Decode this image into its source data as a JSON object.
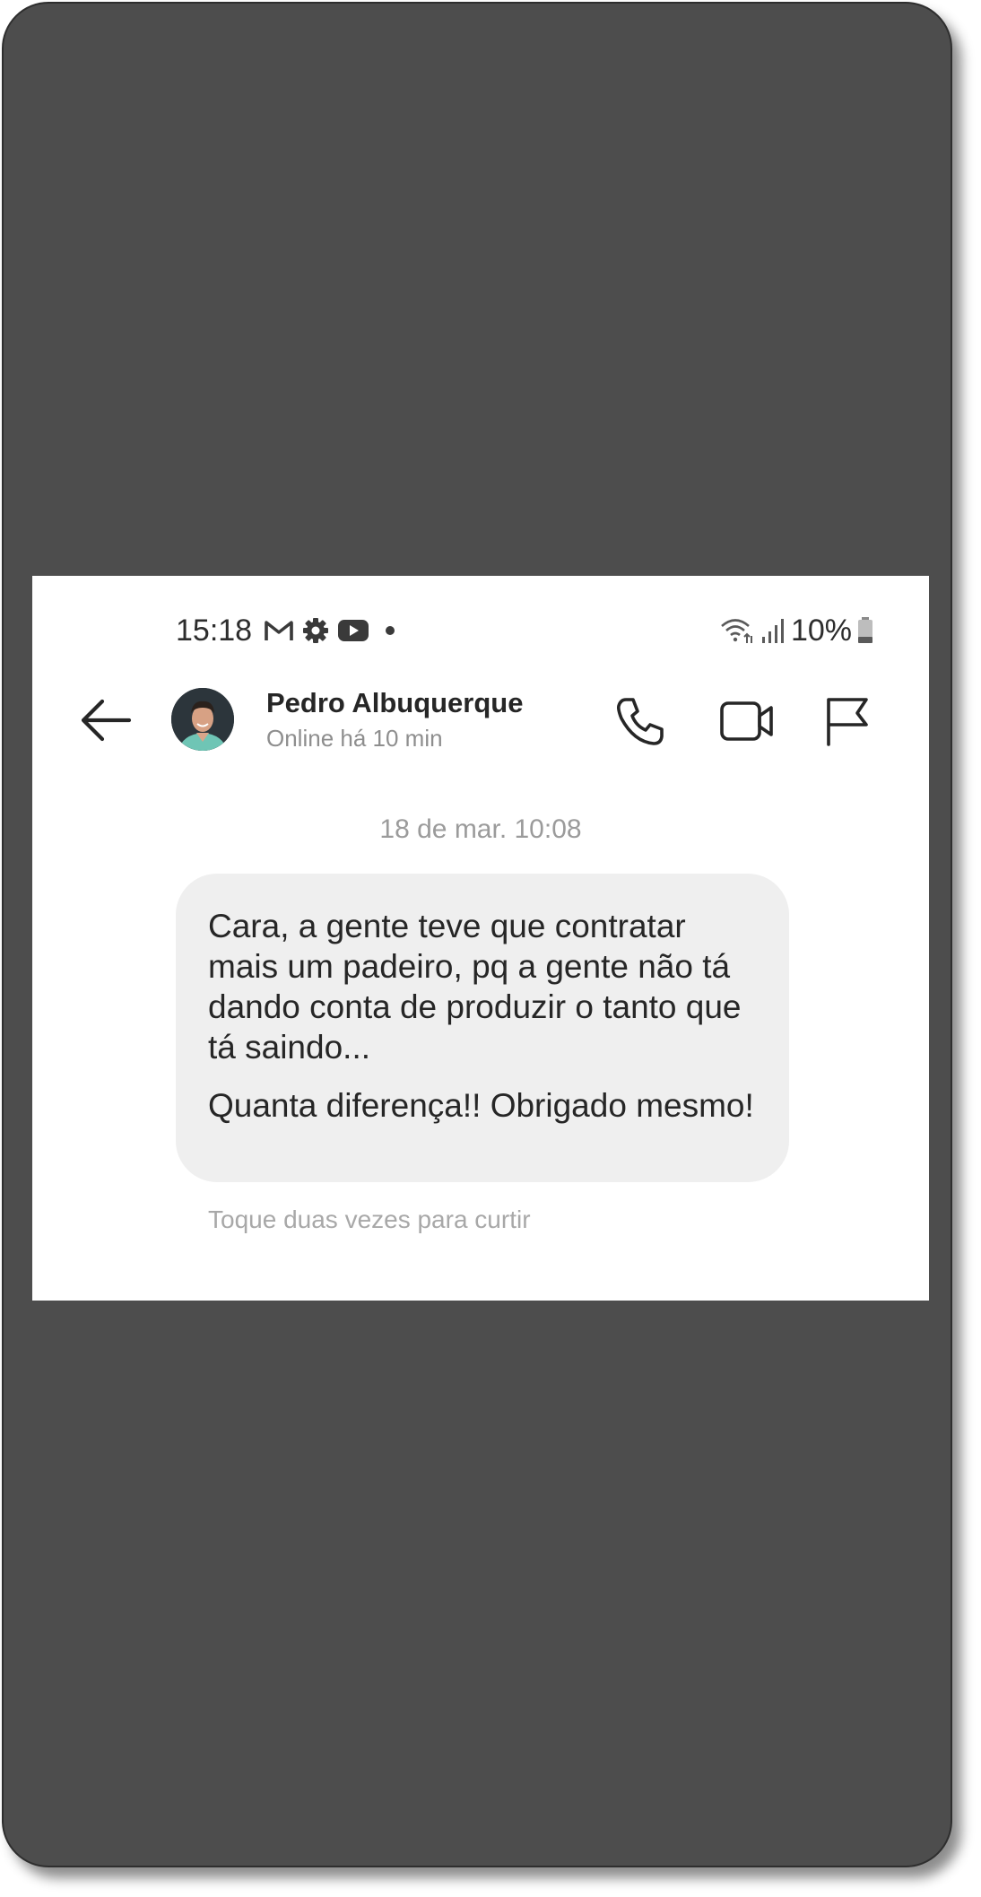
{
  "status_bar": {
    "time": "15:18",
    "left_icons": [
      "gmail-icon",
      "settings-icon",
      "youtube-icon",
      "notification-dot-icon"
    ],
    "right_icons": [
      "wifi-icon",
      "signal-icon",
      "battery-icon"
    ],
    "battery": "10%"
  },
  "header": {
    "contact_name": "Pedro Albuquerque",
    "contact_status": "Online há 10 min",
    "icons": [
      "back-arrow-icon",
      "phone-icon",
      "video-camera-icon",
      "flag-icon"
    ]
  },
  "conversation": {
    "date_separator": "18 de mar. 10:08",
    "message": {
      "paragraph_1": "Cara, a gente teve que contratar mais um padeiro, pq a gente não tá dando conta de produzir o tanto que tá saindo...",
      "paragraph_2": "Quanta diferença!! Obrigado mesmo!"
    },
    "like_hint": "Toque duas vezes para curtir"
  },
  "colors": {
    "frame": "#4d4d4d",
    "screen": "#ffffff",
    "bubble": "#efefef",
    "text_primary": "#262626",
    "text_secondary": "#8e8e8e"
  }
}
